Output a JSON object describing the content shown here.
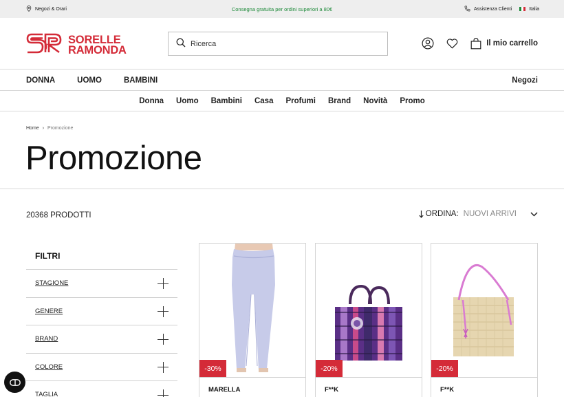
{
  "topbar": {
    "stores_label": "Negozi & Orari",
    "shipping_message": "Consegna gratuita per ordini superiori a 80€",
    "support_label": "Assistenza Clienti",
    "country_label": "Italia"
  },
  "header": {
    "logo_line1": "SORELLE",
    "logo_line2": "RAMONDA",
    "search_placeholder": "Ricerca",
    "cart_label": "Il mio carrello"
  },
  "nav_primary": {
    "items": [
      "DONNA",
      "UOMO",
      "BAMBINI"
    ],
    "stores_link": "Negozi"
  },
  "nav_secondary": {
    "items": [
      "Donna",
      "Uomo",
      "Bambini",
      "Casa",
      "Profumi",
      "Brand",
      "Novità",
      "Promo"
    ]
  },
  "breadcrumb": {
    "home": "Home",
    "separator": "›",
    "current": "Promozione"
  },
  "page_title": "Promozione",
  "listing": {
    "count_label": "20368 PRODOTTI",
    "sort_label": "ORDINA:",
    "sort_value": "NUOVI ARRIVI"
  },
  "filters": {
    "title": "FILTRI",
    "items": [
      "STAGIONE",
      "GENERE",
      "BRAND",
      "COLORE",
      "TAGLIA"
    ]
  },
  "products": [
    {
      "brand": "MARELLA",
      "discount": "-30%",
      "image": "lilac-trousers"
    },
    {
      "brand": "F**K",
      "discount": "-20%",
      "image": "patterned-tote-bag"
    },
    {
      "brand": "F**K",
      "discount": "-20%",
      "image": "straw-tote-bag"
    }
  ],
  "colors": {
    "brand_red": "#d42b38",
    "shipping_green": "#1e8a3a",
    "topbar_bg": "#eeeeee",
    "chat_button": "#111111"
  }
}
